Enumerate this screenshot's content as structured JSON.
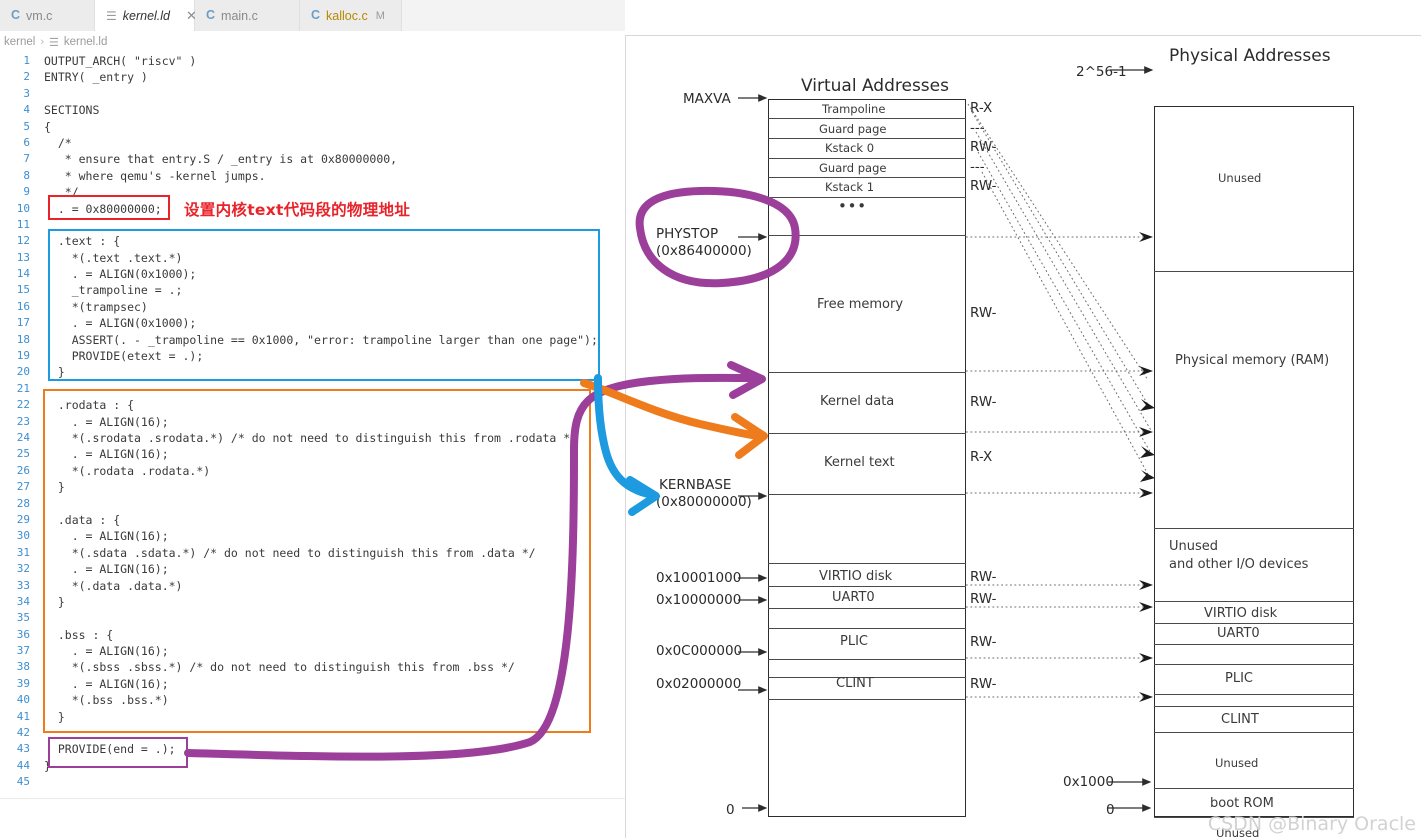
{
  "editor": {
    "tabs": [
      {
        "label": "vm.c",
        "icon": "c-file-icon",
        "active": false,
        "modified": false,
        "close": false
      },
      {
        "label": "kernel.ld",
        "icon": "ld-file-icon",
        "active": true,
        "modified": false,
        "close": true,
        "close_glyph": "✕"
      },
      {
        "label": "main.c",
        "icon": "c-file-icon",
        "active": false,
        "modified": false,
        "close": false
      },
      {
        "label": "kalloc.c",
        "icon": "c-file-icon",
        "active": false,
        "modified": true,
        "modified_flag": "M",
        "close": false
      }
    ],
    "breadcrumb": {
      "root": "kernel",
      "separator": "›",
      "file": "kernel.ld"
    },
    "lines": [
      {
        "n": "1",
        "t": "OUTPUT_ARCH( \"riscv\" )"
      },
      {
        "n": "2",
        "t": "ENTRY( _entry )"
      },
      {
        "n": "3",
        "t": ""
      },
      {
        "n": "4",
        "t": "SECTIONS"
      },
      {
        "n": "5",
        "t": "{"
      },
      {
        "n": "6",
        "t": "  /*"
      },
      {
        "n": "7",
        "t": "   * ensure that entry.S / _entry is at 0x80000000,"
      },
      {
        "n": "8",
        "t": "   * where qemu's -kernel jumps."
      },
      {
        "n": "9",
        "t": "   */"
      },
      {
        "n": "10",
        "t": "  . = 0x80000000;"
      },
      {
        "n": "11",
        "t": ""
      },
      {
        "n": "12",
        "t": "  .text : {"
      },
      {
        "n": "13",
        "t": "    *(.text .text.*)"
      },
      {
        "n": "14",
        "t": "    . = ALIGN(0x1000);"
      },
      {
        "n": "15",
        "t": "    _trampoline = .;"
      },
      {
        "n": "16",
        "t": "    *(trampsec)"
      },
      {
        "n": "17",
        "t": "    . = ALIGN(0x1000);"
      },
      {
        "n": "18",
        "t": "    ASSERT(. - _trampoline == 0x1000, \"error: trampoline larger than one page\");"
      },
      {
        "n": "19",
        "t": "    PROVIDE(etext = .);"
      },
      {
        "n": "20",
        "t": "  }"
      },
      {
        "n": "21",
        "t": ""
      },
      {
        "n": "22",
        "t": "  .rodata : {"
      },
      {
        "n": "23",
        "t": "    . = ALIGN(16);"
      },
      {
        "n": "24",
        "t": "    *(.srodata .srodata.*) /* do not need to distinguish this from .rodata */"
      },
      {
        "n": "25",
        "t": "    . = ALIGN(16);"
      },
      {
        "n": "26",
        "t": "    *(.rodata .rodata.*)"
      },
      {
        "n": "27",
        "t": "  }"
      },
      {
        "n": "28",
        "t": ""
      },
      {
        "n": "29",
        "t": "  .data : {"
      },
      {
        "n": "30",
        "t": "    . = ALIGN(16);"
      },
      {
        "n": "31",
        "t": "    *(.sdata .sdata.*) /* do not need to distinguish this from .data */"
      },
      {
        "n": "32",
        "t": "    . = ALIGN(16);"
      },
      {
        "n": "33",
        "t": "    *(.data .data.*)"
      },
      {
        "n": "34",
        "t": "  }"
      },
      {
        "n": "35",
        "t": ""
      },
      {
        "n": "36",
        "t": "  .bss : {"
      },
      {
        "n": "37",
        "t": "    . = ALIGN(16);"
      },
      {
        "n": "38",
        "t": "    *(.sbss .sbss.*) /* do not need to distinguish this from .bss */"
      },
      {
        "n": "39",
        "t": "    . = ALIGN(16);"
      },
      {
        "n": "40",
        "t": "    *(.bss .bss.*)"
      },
      {
        "n": "41",
        "t": "  }"
      },
      {
        "n": "42",
        "t": ""
      },
      {
        "n": "43",
        "t": "  PROVIDE(end = .);"
      },
      {
        "n": "44",
        "t": "}"
      },
      {
        "n": "45",
        "t": ""
      }
    ],
    "annotation_note": "设置内核text代码段的物理地址"
  },
  "colors": {
    "red": "#e8232a",
    "blue": "#1e9ae0",
    "orange": "#ef7c1c",
    "purple": "#9b3f9b",
    "diagram_line": "#2d2d2d"
  },
  "diagram": {
    "virtual": {
      "title": "Virtual Addresses",
      "top_label": "MAXVA",
      "bottom_label": "0",
      "regions": [
        {
          "label": "Trampoline",
          "perm": "R-X"
        },
        {
          "label": "Guard page",
          "perm": "---"
        },
        {
          "label": "Kstack 0",
          "perm": "RW-"
        },
        {
          "label": "Guard page",
          "perm": "---"
        },
        {
          "label": "Kstack 1",
          "perm": "RW-"
        },
        {
          "label": "• • •",
          "perm": ""
        },
        {
          "label": "Free memory",
          "perm": "RW-"
        },
        {
          "label": "Kernel data",
          "perm": "RW-"
        },
        {
          "label": "Kernel text",
          "perm": "R-X"
        },
        {
          "label": "VIRTIO disk",
          "perm": "RW-"
        },
        {
          "label": "UART0",
          "perm": "RW-"
        },
        {
          "label": "PLIC",
          "perm": "RW-"
        },
        {
          "label": "CLINT",
          "perm": "RW-"
        }
      ],
      "address_marks": [
        {
          "label": "PHYSTOP",
          "sub": "(0x86400000)",
          "circled": true
        },
        {
          "label": "KERNBASE",
          "sub": "(0x80000000)",
          "circled": false
        },
        {
          "label": "0x10001000",
          "sub": "",
          "circled": false
        },
        {
          "label": "0x10000000",
          "sub": "",
          "circled": false
        },
        {
          "label": "0x0C000000",
          "sub": "",
          "circled": false
        },
        {
          "label": "0x02000000",
          "sub": "",
          "circled": false
        },
        {
          "label": "0",
          "sub": "",
          "circled": false
        }
      ]
    },
    "physical": {
      "title": "Physical Addresses",
      "top_label": "2^56-1",
      "bottom_label": "0",
      "boot_rom_label": "0x1000",
      "regions": [
        {
          "label": "Unused"
        },
        {
          "label": "Physical memory (RAM)"
        },
        {
          "label": "Unused",
          "label2": "and other I/O devices"
        },
        {
          "label": "VIRTIO disk"
        },
        {
          "label": "UART0"
        },
        {
          "label": "PLIC"
        },
        {
          "label": "CLINT"
        },
        {
          "label": "Unused"
        },
        {
          "label": "boot ROM"
        },
        {
          "label": "Unused"
        }
      ]
    }
  },
  "watermark": "CSDN @Binary Oracle"
}
